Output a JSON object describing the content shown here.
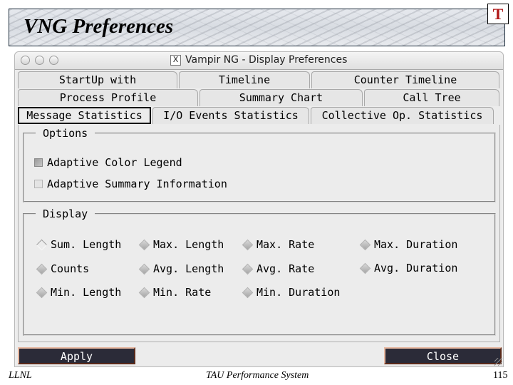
{
  "slide": {
    "title": "VNG Preferences",
    "logo_icon": "tau-logo-icon",
    "logo_glyph": "T",
    "footer_left": "LLNL",
    "footer_center": "TAU Performance System",
    "page_number": "115"
  },
  "window": {
    "title": "Vampir NG - Display Preferences",
    "title_icon_glyph": "X"
  },
  "tabs": {
    "row1": [
      {
        "label": "StartUp with"
      },
      {
        "label": "Timeline"
      },
      {
        "label": "Counter Timeline"
      }
    ],
    "row2": [
      {
        "label": "Process Profile"
      },
      {
        "label": "Summary Chart"
      },
      {
        "label": "Call Tree"
      }
    ],
    "row3": [
      {
        "label": "Message Statistics",
        "active": true
      },
      {
        "label": "I/O Events Statistics"
      },
      {
        "label": "Collective Op. Statistics"
      }
    ]
  },
  "options": {
    "legend": "Options",
    "items": [
      {
        "label": "Adaptive Color Legend",
        "checked": true
      },
      {
        "label": "Adaptive Summary Information",
        "checked": false
      }
    ]
  },
  "display": {
    "legend": "Display",
    "selected": "Sum. Length",
    "items": [
      {
        "label": "Sum. Length"
      },
      {
        "label": "Max. Length"
      },
      {
        "label": "Max. Rate"
      },
      {
        "label": "Max. Duration"
      },
      {
        "label": "Counts"
      },
      {
        "label": "Avg. Length"
      },
      {
        "label": "Avg. Rate"
      },
      {
        "label": "Avg. Duration"
      },
      {
        "label": "Min. Length"
      },
      {
        "label": "Min. Rate"
      },
      {
        "label": "Min. Duration"
      }
    ]
  },
  "buttons": {
    "apply": "Apply",
    "close": "Close"
  }
}
